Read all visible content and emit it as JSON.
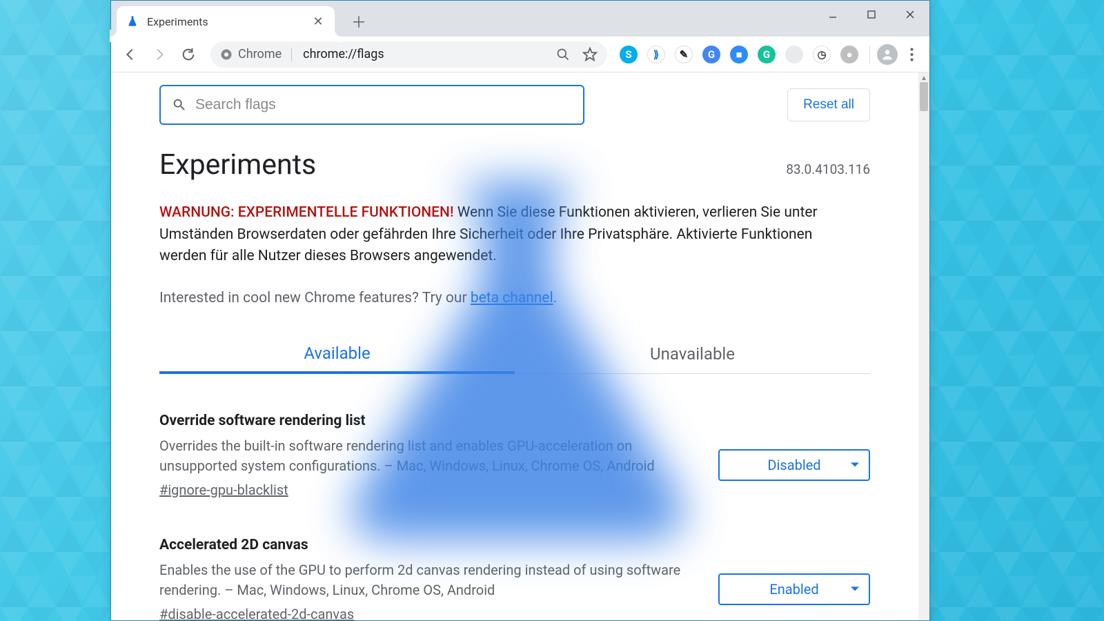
{
  "tab": {
    "title": "Experiments"
  },
  "omnibox": {
    "chip_label": "Chrome",
    "url": "chrome://flags"
  },
  "extensions": [
    {
      "name": "skype-icon",
      "bg": "#00aff0",
      "glyph": "S"
    },
    {
      "name": "cast-icon",
      "bg": "#ffffff",
      "glyph": "⟫",
      "fg": "#0b74de"
    },
    {
      "name": "colorpicker-icon",
      "bg": "#ffffff",
      "glyph": "✎",
      "fg": "#1a1a1a"
    },
    {
      "name": "translate-icon",
      "bg": "#4285f4",
      "glyph": "G"
    },
    {
      "name": "zoom-icon",
      "bg": "#2d8cff",
      "glyph": "■"
    },
    {
      "name": "grammarly-icon",
      "bg": "#15c39a",
      "glyph": "G"
    },
    {
      "name": "placeholder-icon",
      "bg": "#e8eaed",
      "glyph": "",
      "fg": "#9aa0a6"
    },
    {
      "name": "clock-icon",
      "bg": "#ffffff",
      "glyph": "◷",
      "fg": "#444"
    },
    {
      "name": "chat-icon",
      "bg": "#bfbfbf",
      "glyph": "●",
      "fg": "#fff"
    }
  ],
  "search": {
    "placeholder": "Search flags"
  },
  "reset_label": "Reset all",
  "page_title": "Experiments",
  "version": "83.0.4103.116",
  "warning": {
    "prefix": "WARNUNG: EXPERIMENTELLE FUNKTIONEN!",
    "body": " Wenn Sie diese Funktionen aktivieren, verlieren Sie unter Umständen Browserdaten oder gefährden Ihre Sicherheit oder Ihre Privatsphäre. Aktivierte Funktionen werden für alle Nutzer dieses Browsers angewendet."
  },
  "beta": {
    "pre": "Interested in cool new Chrome features? Try our ",
    "link": "beta channel",
    "post": "."
  },
  "tabs": {
    "available": "Available",
    "unavailable": "Unavailable"
  },
  "flags": [
    {
      "title": "Override software rendering list",
      "desc": "Overrides the built-in software rendering list and enables GPU-acceleration on unsupported system configurations. – Mac, Windows, Linux, Chrome OS, Android",
      "hash": "#ignore-gpu-blacklist",
      "value": "Disabled"
    },
    {
      "title": "Accelerated 2D canvas",
      "desc": "Enables the use of the GPU to perform 2d canvas rendering instead of using software rendering. – Mac, Windows, Linux, Chrome OS, Android",
      "hash": "#disable-accelerated-2d-canvas",
      "value": "Enabled"
    }
  ]
}
